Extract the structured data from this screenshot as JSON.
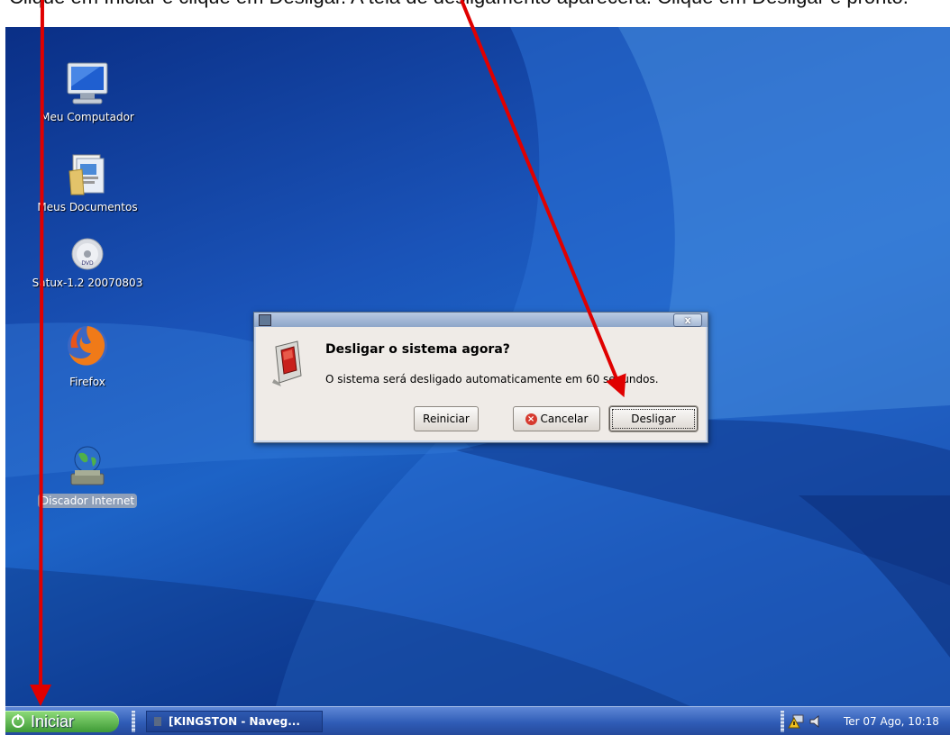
{
  "document": {
    "caption": "Clique em Iniciar e clique em Desligar. A tela de desligamento aparecerá. Clique em Desligar e pronto."
  },
  "desktop": {
    "icons": [
      {
        "label": "Meu Computador",
        "icon": "computer-icon"
      },
      {
        "label": "Meus Documentos",
        "icon": "documents-folder-icon"
      },
      {
        "label": "Satux-1.2 20070803",
        "icon": "dvd-icon"
      },
      {
        "label": "Firefox",
        "icon": "firefox-icon"
      },
      {
        "label": "Discador Internet",
        "icon": "dialer-globe-icon"
      }
    ]
  },
  "dialog": {
    "heading": "Desligar o sistema agora?",
    "message": "O sistema será desligado automaticamente em 60 segundos.",
    "close_label": "x",
    "buttons": {
      "restart": "Reiniciar",
      "cancel": "Cancelar",
      "shutdown": "Desligar"
    }
  },
  "taskbar": {
    "start_label": "Iniciar",
    "task_label": "[KINGSTON - Naveg...",
    "clock": "Ter 07 Ago, 10:18"
  },
  "colors": {
    "annotation_arrow": "#e00000",
    "desktop_blue": "#1a53b8",
    "start_green": "#3e9a36"
  }
}
